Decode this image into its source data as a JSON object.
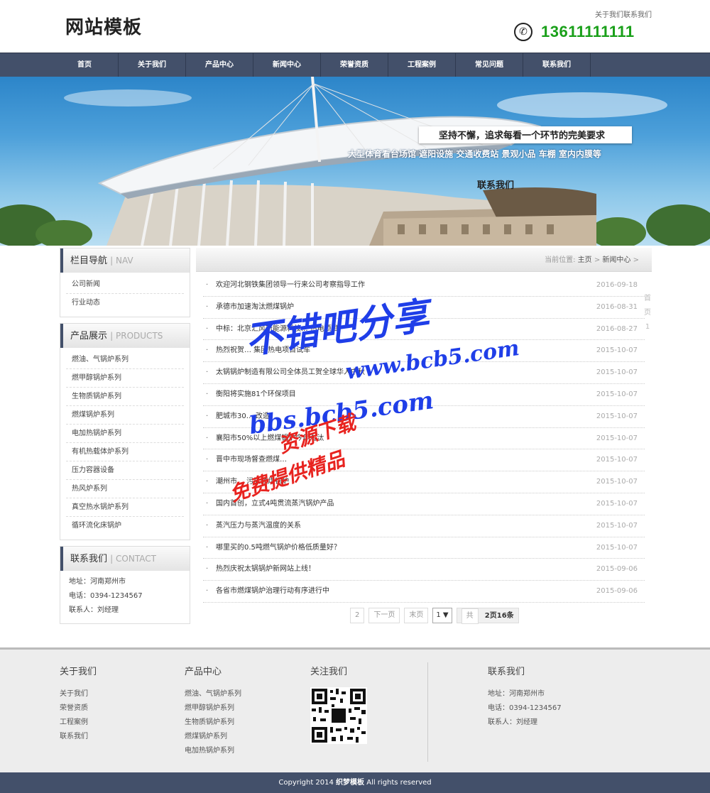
{
  "header": {
    "logo": "网站模板",
    "top_links": "关于我们联系我们",
    "phone_icon": "phone-icon",
    "phone": "13611111111"
  },
  "nav": {
    "items": [
      "首页",
      "关于我们",
      "产品中心",
      "新闻中心",
      "荣誉资质",
      "工程案例",
      "常见问题",
      "联系我们"
    ]
  },
  "banner": {
    "slogan": "坚持不懈，追求每看一个环节的完美要求",
    "sub": "大型体育看台场馆 遮阳设施 交通收费站 景观小品 车棚 室内内膜等",
    "contact": "联系我们"
  },
  "sidebar": {
    "nav_title": "栏目导航",
    "nav_title_en": "NAV",
    "nav_items": [
      "公司新闻",
      "行业动态"
    ],
    "products_title": "产品展示",
    "products_title_en": "PRODUCTS",
    "products": [
      "燃油、气锅炉系列",
      "燃甲醇锅炉系列",
      "生物质锅炉系列",
      "燃煤锅炉系列",
      "电加热锅炉系列",
      "有机热载体炉系列",
      "压力容器设备",
      "热风炉系列",
      "真空热水锅炉系列",
      "循环流化床锅炉"
    ],
    "contact_title": "联系我们",
    "contact_title_en": "CONTACT",
    "contact_lines": [
      "地址：河南郑州市",
      "电话：0394-1234567",
      "联系人：刘经理"
    ]
  },
  "breadcrumb": {
    "label": "当前位置:",
    "home": "主页",
    "sep1": ">",
    "section": "新闻中心",
    "sep2": ">"
  },
  "news": [
    {
      "title": "欢迎河北钢铁集团领导一行来公司考察指导工作",
      "date": "2016-09-18"
    },
    {
      "title": "承德市加速淘汰燃煤锅炉",
      "date": "2016-08-31"
    },
    {
      "title": "中标：北京汇风新能源科技... 热电项目",
      "date": "2016-08-27"
    },
    {
      "title": "热烈祝贺… 集团热电项目试车",
      "date": "2015-10-07"
    },
    {
      "title": "太锅锅炉制造有限公司全体员工贺全球华人中秋",
      "date": "2015-10-07"
    },
    {
      "title": "衡阳将实施81个环保项目",
      "date": "2015-10-07"
    },
    {
      "title": "肥城市30… 改造",
      "date": "2015-10-07"
    },
    {
      "title": "襄阳市50%以上燃煤锅炉今年淘汰",
      "date": "2015-10-07"
    },
    {
      "title": "晋中市现场督查燃煤…",
      "date": "2015-10-07"
    },
    {
      "title": "潮州市… 污染燃煤锅炉",
      "date": "2015-10-07"
    },
    {
      "title": "国内首创，立式4吨贯流蒸汽锅炉产品",
      "date": "2015-10-07"
    },
    {
      "title": "蒸汽压力与蒸汽温度的关系",
      "date": "2015-10-07"
    },
    {
      "title": "哪里买的0.5吨燃气锅炉价格低质量好？",
      "date": "2015-10-07"
    },
    {
      "title": "热烈庆祝太锅锅炉新网站上线！",
      "date": "2015-09-06"
    },
    {
      "title": "各省市燃煤锅炉治理行动有序进行中",
      "date": "2015-09-06"
    }
  ],
  "side_pager": [
    "首",
    "页",
    "1"
  ],
  "pager": {
    "page2": "2",
    "next": "下一页",
    "last": "末页",
    "select": "1 ▼",
    "total_prefix": "共",
    "total_bold": "2页16条"
  },
  "footer": {
    "about_title": "关于我们",
    "about_links": [
      "关于我们",
      "荣誉资质",
      "工程案例",
      "联系我们"
    ],
    "products_title": "产品中心",
    "products_links": [
      "燃油、气锅炉系列",
      "燃甲醇锅炉系列",
      "生物质锅炉系列",
      "燃煤锅炉系列",
      "电加热锅炉系列"
    ],
    "follow_title": "关注我们",
    "qr_icon": "qr-code",
    "contact_title": "联系我们",
    "contact_lines": [
      "地址：河南郑州市",
      "电话：0394-1234567",
      "联系人：刘经理"
    ]
  },
  "copyright": {
    "prefix": "Copyright 2014 ",
    "brand": "织梦模板",
    "suffix": " All rights reserved"
  },
  "watermark": [
    "不错吧分享",
    "www.bcb5.com",
    "bbs.bcb5.com",
    "资源下载",
    "免费提供精品"
  ],
  "colors": {
    "nav_bg": "#43506a",
    "phone": "#1aa01a",
    "watermark_blue": "#1f3ee8",
    "watermark_red": "#e8231f"
  }
}
